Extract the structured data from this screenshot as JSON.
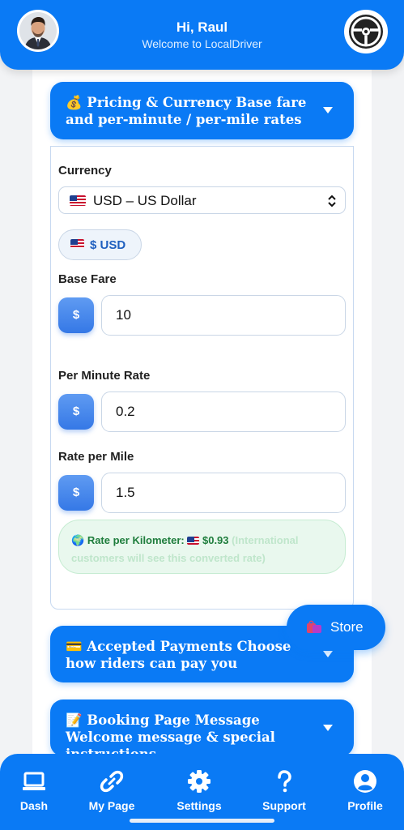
{
  "header": {
    "greeting": "Hi, Raul",
    "subtitle": "Welcome to LocalDriver"
  },
  "sections": {
    "pricing": {
      "emoji": "💰",
      "title": "Pricing & Currency Base fare and per-minute / per-mile rates"
    },
    "payments": {
      "emoji": "💳",
      "title": "Accepted Payments Choose how riders can pay you"
    },
    "booking": {
      "emoji": "📝",
      "title": "Booking Page Message Welcome message & special instructions"
    }
  },
  "pricing": {
    "currency_label": "Currency",
    "currency_value": "USD – US Dollar",
    "currency_pill": "$ USD",
    "base_fare_label": "Base Fare",
    "base_fare_value": "10",
    "per_minute_label": "Per Minute Rate",
    "per_minute_value": "0.2",
    "per_mile_label": "Rate per Mile",
    "per_mile_value": "1.5",
    "dollar_symbol": "$",
    "km_label": "Rate per Kilometer:",
    "km_value": "$0.93",
    "km_note": "(International customers will see this converted rate)"
  },
  "store": {
    "label": "Store"
  },
  "nav": [
    {
      "label": "Dash",
      "icon": "laptop-icon"
    },
    {
      "label": "My Page",
      "icon": "link-icon"
    },
    {
      "label": "Settings",
      "icon": "gear-icon"
    },
    {
      "label": "Support",
      "icon": "question-icon"
    },
    {
      "label": "Profile",
      "icon": "profile-icon"
    }
  ],
  "colors": {
    "primary": "#0a7af5",
    "success_text": "#1e7d3c",
    "success_bg": "#e9f8ee"
  }
}
